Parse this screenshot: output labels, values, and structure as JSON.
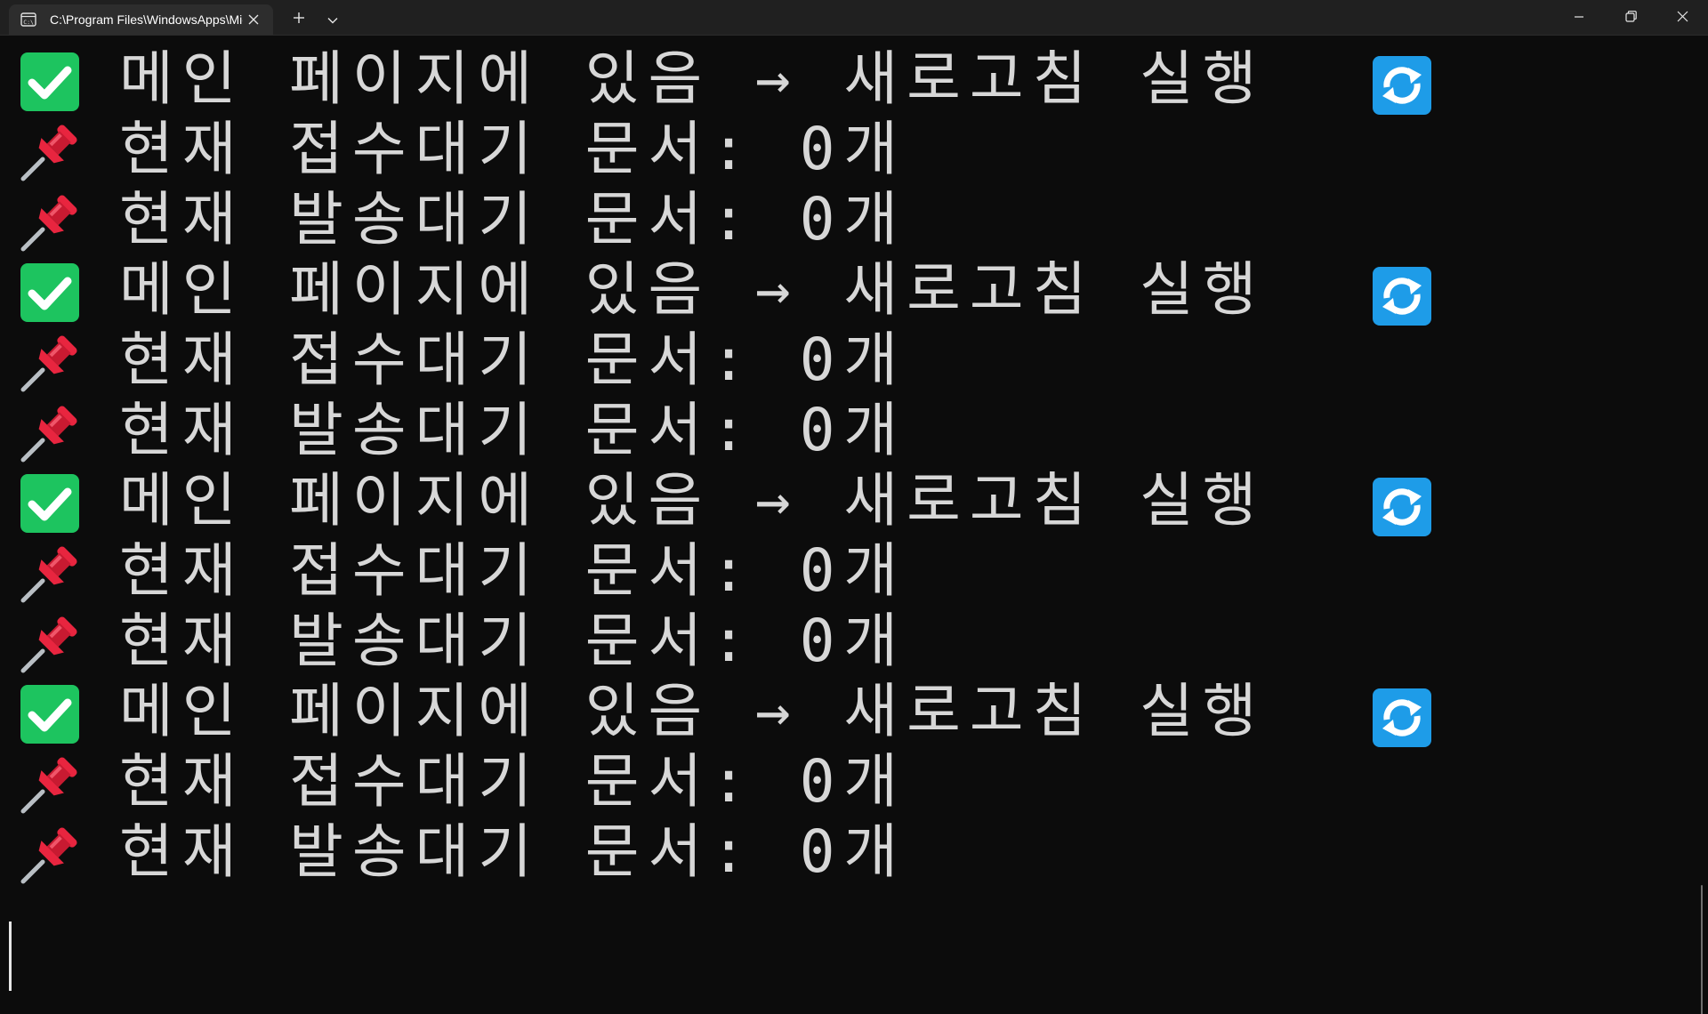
{
  "window": {
    "tab_title": "C:\\Program Files\\WindowsApps\\Microsoft.WindowsTerminal"
  },
  "icons": {
    "tab": "console-icon",
    "close": "close-icon",
    "new_tab": "plus-icon",
    "dropdown": "chevron-down-icon",
    "minimize": "minimize-icon",
    "maximize": "restore-icon",
    "window_close": "close-icon",
    "check": "check-mark-emoji",
    "pin": "pushpin-emoji",
    "refresh": "refresh-emoji"
  },
  "colors": {
    "background": "#0c0c0c",
    "titlebar": "#202020",
    "tab": "#2d2d2d",
    "text": "#d7d7d7",
    "check_green": "#1dc45f",
    "pin_red": "#e8253f",
    "refresh_blue": "#1e9ce8"
  },
  "output": {
    "lines": [
      {
        "type": "check",
        "text": "메인 페이지에 있음 → 새로고침 실행"
      },
      {
        "type": "pin",
        "text": "현재 접수대기 문서: 0개"
      },
      {
        "type": "pin",
        "text": "현재 발송대기 문서: 0개"
      },
      {
        "type": "check",
        "text": "메인 페이지에 있음 → 새로고침 실행"
      },
      {
        "type": "pin",
        "text": "현재 접수대기 문서: 0개"
      },
      {
        "type": "pin",
        "text": "현재 발송대기 문서: 0개"
      },
      {
        "type": "check",
        "text": "메인 페이지에 있음 → 새로고침 실행"
      },
      {
        "type": "pin",
        "text": "현재 접수대기 문서: 0개"
      },
      {
        "type": "pin",
        "text": "현재 발송대기 문서: 0개"
      },
      {
        "type": "check",
        "text": "메인 페이지에 있음 → 새로고침 실행"
      },
      {
        "type": "pin",
        "text": "현재 접수대기 문서: 0개"
      },
      {
        "type": "pin",
        "text": "현재 발송대기 문서: 0개"
      }
    ]
  }
}
